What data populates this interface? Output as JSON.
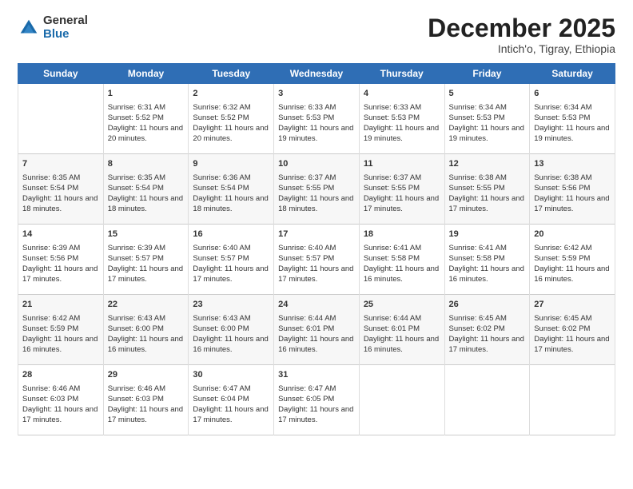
{
  "logo": {
    "general": "General",
    "blue": "Blue"
  },
  "header": {
    "month": "December 2025",
    "location": "Intich'o, Tigray, Ethiopia"
  },
  "weekdays": [
    "Sunday",
    "Monday",
    "Tuesday",
    "Wednesday",
    "Thursday",
    "Friday",
    "Saturday"
  ],
  "weeks": [
    [
      {
        "day": "",
        "sunrise": "",
        "sunset": "",
        "daylight": ""
      },
      {
        "day": "1",
        "sunrise": "Sunrise: 6:31 AM",
        "sunset": "Sunset: 5:52 PM",
        "daylight": "Daylight: 11 hours and 20 minutes."
      },
      {
        "day": "2",
        "sunrise": "Sunrise: 6:32 AM",
        "sunset": "Sunset: 5:52 PM",
        "daylight": "Daylight: 11 hours and 20 minutes."
      },
      {
        "day": "3",
        "sunrise": "Sunrise: 6:33 AM",
        "sunset": "Sunset: 5:53 PM",
        "daylight": "Daylight: 11 hours and 19 minutes."
      },
      {
        "day": "4",
        "sunrise": "Sunrise: 6:33 AM",
        "sunset": "Sunset: 5:53 PM",
        "daylight": "Daylight: 11 hours and 19 minutes."
      },
      {
        "day": "5",
        "sunrise": "Sunrise: 6:34 AM",
        "sunset": "Sunset: 5:53 PM",
        "daylight": "Daylight: 11 hours and 19 minutes."
      },
      {
        "day": "6",
        "sunrise": "Sunrise: 6:34 AM",
        "sunset": "Sunset: 5:53 PM",
        "daylight": "Daylight: 11 hours and 19 minutes."
      }
    ],
    [
      {
        "day": "7",
        "sunrise": "Sunrise: 6:35 AM",
        "sunset": "Sunset: 5:54 PM",
        "daylight": "Daylight: 11 hours and 18 minutes."
      },
      {
        "day": "8",
        "sunrise": "Sunrise: 6:35 AM",
        "sunset": "Sunset: 5:54 PM",
        "daylight": "Daylight: 11 hours and 18 minutes."
      },
      {
        "day": "9",
        "sunrise": "Sunrise: 6:36 AM",
        "sunset": "Sunset: 5:54 PM",
        "daylight": "Daylight: 11 hours and 18 minutes."
      },
      {
        "day": "10",
        "sunrise": "Sunrise: 6:37 AM",
        "sunset": "Sunset: 5:55 PM",
        "daylight": "Daylight: 11 hours and 18 minutes."
      },
      {
        "day": "11",
        "sunrise": "Sunrise: 6:37 AM",
        "sunset": "Sunset: 5:55 PM",
        "daylight": "Daylight: 11 hours and 17 minutes."
      },
      {
        "day": "12",
        "sunrise": "Sunrise: 6:38 AM",
        "sunset": "Sunset: 5:55 PM",
        "daylight": "Daylight: 11 hours and 17 minutes."
      },
      {
        "day": "13",
        "sunrise": "Sunrise: 6:38 AM",
        "sunset": "Sunset: 5:56 PM",
        "daylight": "Daylight: 11 hours and 17 minutes."
      }
    ],
    [
      {
        "day": "14",
        "sunrise": "Sunrise: 6:39 AM",
        "sunset": "Sunset: 5:56 PM",
        "daylight": "Daylight: 11 hours and 17 minutes."
      },
      {
        "day": "15",
        "sunrise": "Sunrise: 6:39 AM",
        "sunset": "Sunset: 5:57 PM",
        "daylight": "Daylight: 11 hours and 17 minutes."
      },
      {
        "day": "16",
        "sunrise": "Sunrise: 6:40 AM",
        "sunset": "Sunset: 5:57 PM",
        "daylight": "Daylight: 11 hours and 17 minutes."
      },
      {
        "day": "17",
        "sunrise": "Sunrise: 6:40 AM",
        "sunset": "Sunset: 5:57 PM",
        "daylight": "Daylight: 11 hours and 17 minutes."
      },
      {
        "day": "18",
        "sunrise": "Sunrise: 6:41 AM",
        "sunset": "Sunset: 5:58 PM",
        "daylight": "Daylight: 11 hours and 16 minutes."
      },
      {
        "day": "19",
        "sunrise": "Sunrise: 6:41 AM",
        "sunset": "Sunset: 5:58 PM",
        "daylight": "Daylight: 11 hours and 16 minutes."
      },
      {
        "day": "20",
        "sunrise": "Sunrise: 6:42 AM",
        "sunset": "Sunset: 5:59 PM",
        "daylight": "Daylight: 11 hours and 16 minutes."
      }
    ],
    [
      {
        "day": "21",
        "sunrise": "Sunrise: 6:42 AM",
        "sunset": "Sunset: 5:59 PM",
        "daylight": "Daylight: 11 hours and 16 minutes."
      },
      {
        "day": "22",
        "sunrise": "Sunrise: 6:43 AM",
        "sunset": "Sunset: 6:00 PM",
        "daylight": "Daylight: 11 hours and 16 minutes."
      },
      {
        "day": "23",
        "sunrise": "Sunrise: 6:43 AM",
        "sunset": "Sunset: 6:00 PM",
        "daylight": "Daylight: 11 hours and 16 minutes."
      },
      {
        "day": "24",
        "sunrise": "Sunrise: 6:44 AM",
        "sunset": "Sunset: 6:01 PM",
        "daylight": "Daylight: 11 hours and 16 minutes."
      },
      {
        "day": "25",
        "sunrise": "Sunrise: 6:44 AM",
        "sunset": "Sunset: 6:01 PM",
        "daylight": "Daylight: 11 hours and 16 minutes."
      },
      {
        "day": "26",
        "sunrise": "Sunrise: 6:45 AM",
        "sunset": "Sunset: 6:02 PM",
        "daylight": "Daylight: 11 hours and 17 minutes."
      },
      {
        "day": "27",
        "sunrise": "Sunrise: 6:45 AM",
        "sunset": "Sunset: 6:02 PM",
        "daylight": "Daylight: 11 hours and 17 minutes."
      }
    ],
    [
      {
        "day": "28",
        "sunrise": "Sunrise: 6:46 AM",
        "sunset": "Sunset: 6:03 PM",
        "daylight": "Daylight: 11 hours and 17 minutes."
      },
      {
        "day": "29",
        "sunrise": "Sunrise: 6:46 AM",
        "sunset": "Sunset: 6:03 PM",
        "daylight": "Daylight: 11 hours and 17 minutes."
      },
      {
        "day": "30",
        "sunrise": "Sunrise: 6:47 AM",
        "sunset": "Sunset: 6:04 PM",
        "daylight": "Daylight: 11 hours and 17 minutes."
      },
      {
        "day": "31",
        "sunrise": "Sunrise: 6:47 AM",
        "sunset": "Sunset: 6:05 PM",
        "daylight": "Daylight: 11 hours and 17 minutes."
      },
      {
        "day": "",
        "sunrise": "",
        "sunset": "",
        "daylight": ""
      },
      {
        "day": "",
        "sunrise": "",
        "sunset": "",
        "daylight": ""
      },
      {
        "day": "",
        "sunrise": "",
        "sunset": "",
        "daylight": ""
      }
    ]
  ]
}
